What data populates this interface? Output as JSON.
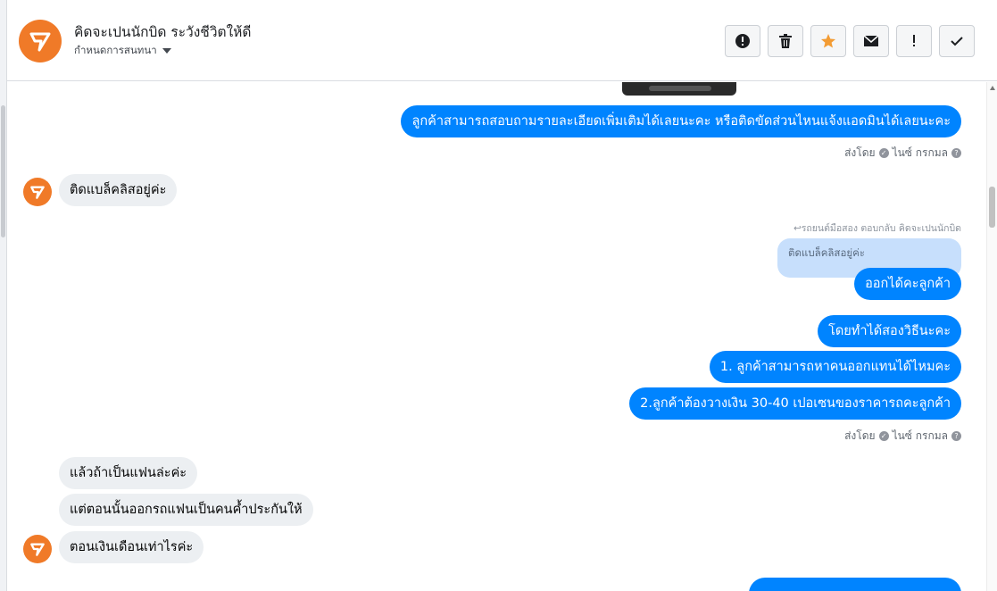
{
  "header": {
    "title": "คิดจะเปนนักบิด ระวังชีวิตให้ดี",
    "subtitle": "กำหนดการสนทนา",
    "buttons": [
      {
        "name": "alert-button",
        "icon": "exclamation-circle-icon",
        "glyph": "●"
      },
      {
        "name": "delete-button",
        "icon": "trash-icon",
        "glyph": "🗑"
      },
      {
        "name": "star-button",
        "icon": "star-icon",
        "glyph": "★"
      },
      {
        "name": "mail-button",
        "icon": "envelope-icon",
        "glyph": "✉"
      },
      {
        "name": "important-button",
        "icon": "exclamation-icon",
        "glyph": "!"
      },
      {
        "name": "done-button",
        "icon": "check-icon",
        "glyph": "✓"
      }
    ]
  },
  "colors": {
    "accent": "#0084ff",
    "brand": "#f07a28",
    "incoming": "#eceff2",
    "quoted": "#c7dffc"
  },
  "messages": {
    "m1": "ลูกค้าสามารถสอบถามรายละเอียดเพิ่มเติมได้เลยนะคะ หรือติดขัดส่วนไหนแจ้งแอดมินได้เลยนะคะ",
    "meta1": "ส่งโดย",
    "meta1_name": "ไนซ์ กรกมล",
    "in1": "ติดแบล็คลิสอยู่ค่ะ",
    "reply_note": "↩รถยนต์มือสอง ตอบกลับ คิดจะเปนนักบิด",
    "quoted": "ติดแบล็คลิสอยู่ค่ะ",
    "m2": "ออกได้คะลูกค้า",
    "m3": "โดยทำได้สองวิธีนะคะ",
    "m4": "1. ลูกค้าสามารถหาคนออกแทนได้ไหมคะ",
    "m5": "2.ลูกค้าต้องวางเงิน 30-40 เปอเซนของราคารถคะลูกค้า",
    "meta2": "ส่งโดย",
    "meta2_name": "ไนซ์ กรกมล",
    "in2": "แล้วถ้าเป็นแฟนล่ะค่ะ",
    "in3": "แต่ตอนนั้นออกรถแฟนเป็นคนค้ำประกันให้",
    "in4": "ตอนเงินเดือนเท่าไรค่ะ"
  }
}
